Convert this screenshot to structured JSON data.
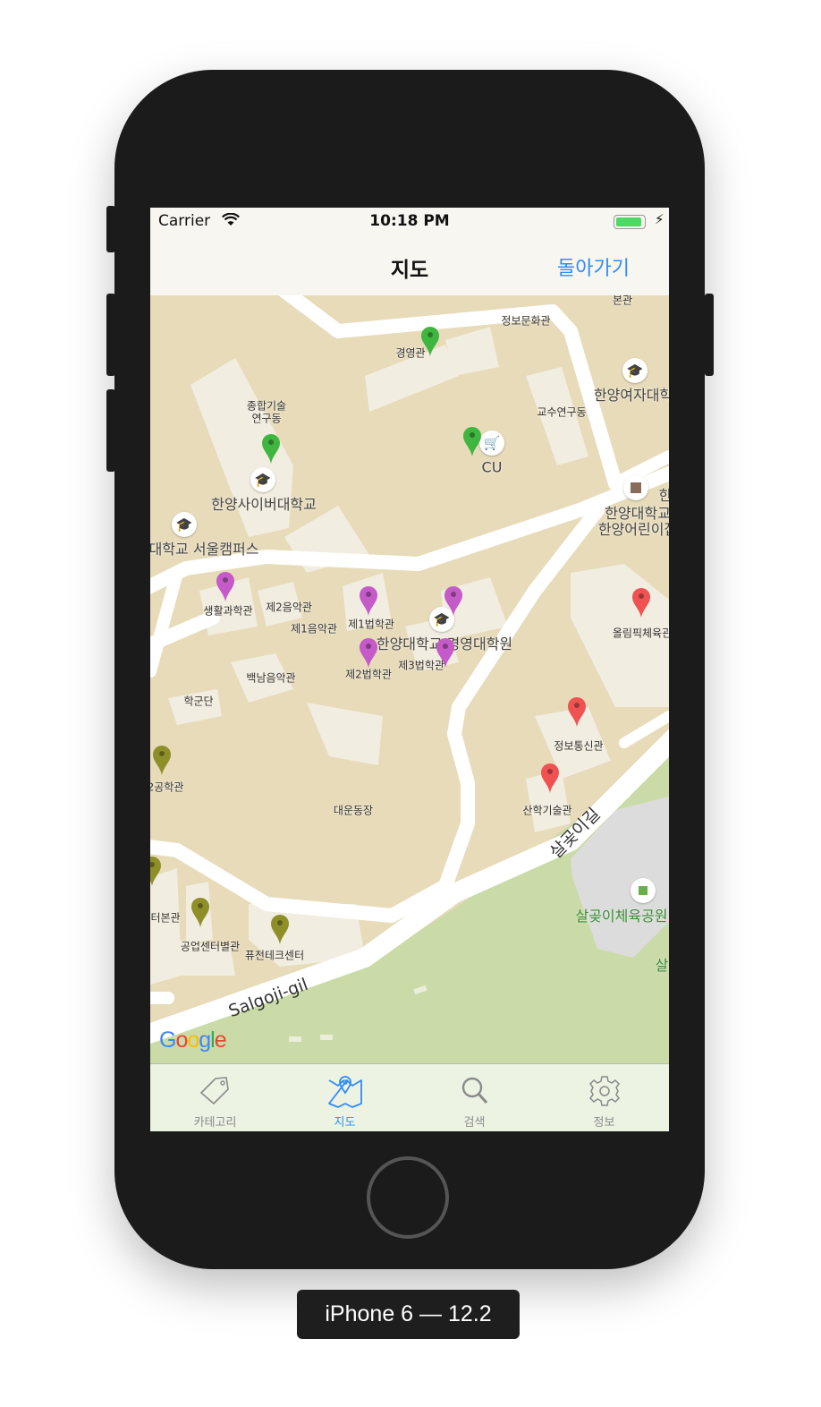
{
  "status_bar": {
    "carrier": "Carrier",
    "time": "10:18 PM",
    "battery_percent": 100
  },
  "nav": {
    "title": "지도",
    "back_label": "돌아가기"
  },
  "map": {
    "labels": {
      "bongwan": "본관",
      "info_culture": "정보문화관",
      "business": "경영관",
      "hanyang_women": "한양여자대학",
      "faculty": "교수연구동",
      "tech_research_1": "종합기술",
      "tech_research_2": "연구동",
      "cu": "CU",
      "cyber_univ": "한양사이버대학교",
      "han": "한",
      "hanyang_univ": "한양대학교",
      "daycare": "한양어린이집",
      "seoul_campus": "대학교 서울캠퍼스",
      "human_ecology": "생활과학관",
      "music2": "제2음악관",
      "music1": "제1음악관",
      "law1": "제1법학관",
      "grad_business": "한양대학교 경영대학원",
      "law3": "제3법학관",
      "law2": "제2법학관",
      "baeknam": "백남음악관",
      "olympic_gym": "올림픽체육관",
      "rotc": "학군단",
      "it_center": "정보통신관",
      "eng2": "2공학관",
      "industry_tech": "산학기술관",
      "stadium": "대운동장",
      "salgoji_road_kr": "살곶이길",
      "center_main": "터본관",
      "industry_annex": "공업센터별관",
      "fusion_tech": "퓨전테크센터",
      "salgoji_park": "살곶이체육공원",
      "sal": "살",
      "salgoji_road_en": "Salgoji-gil"
    },
    "pin_colors": {
      "green": "#3fb63f",
      "magenta": "#c45bc8",
      "red": "#f05252",
      "olive": "#8f8f2a"
    },
    "attribution": "Google"
  },
  "tabs": [
    {
      "label": "카테고리",
      "icon": "tag-icon"
    },
    {
      "label": "지도",
      "icon": "map-icon",
      "active": true
    },
    {
      "label": "검색",
      "icon": "search-icon"
    },
    {
      "label": "정보",
      "icon": "gear-icon"
    }
  ],
  "device_label": "iPhone 6 — 12.2"
}
